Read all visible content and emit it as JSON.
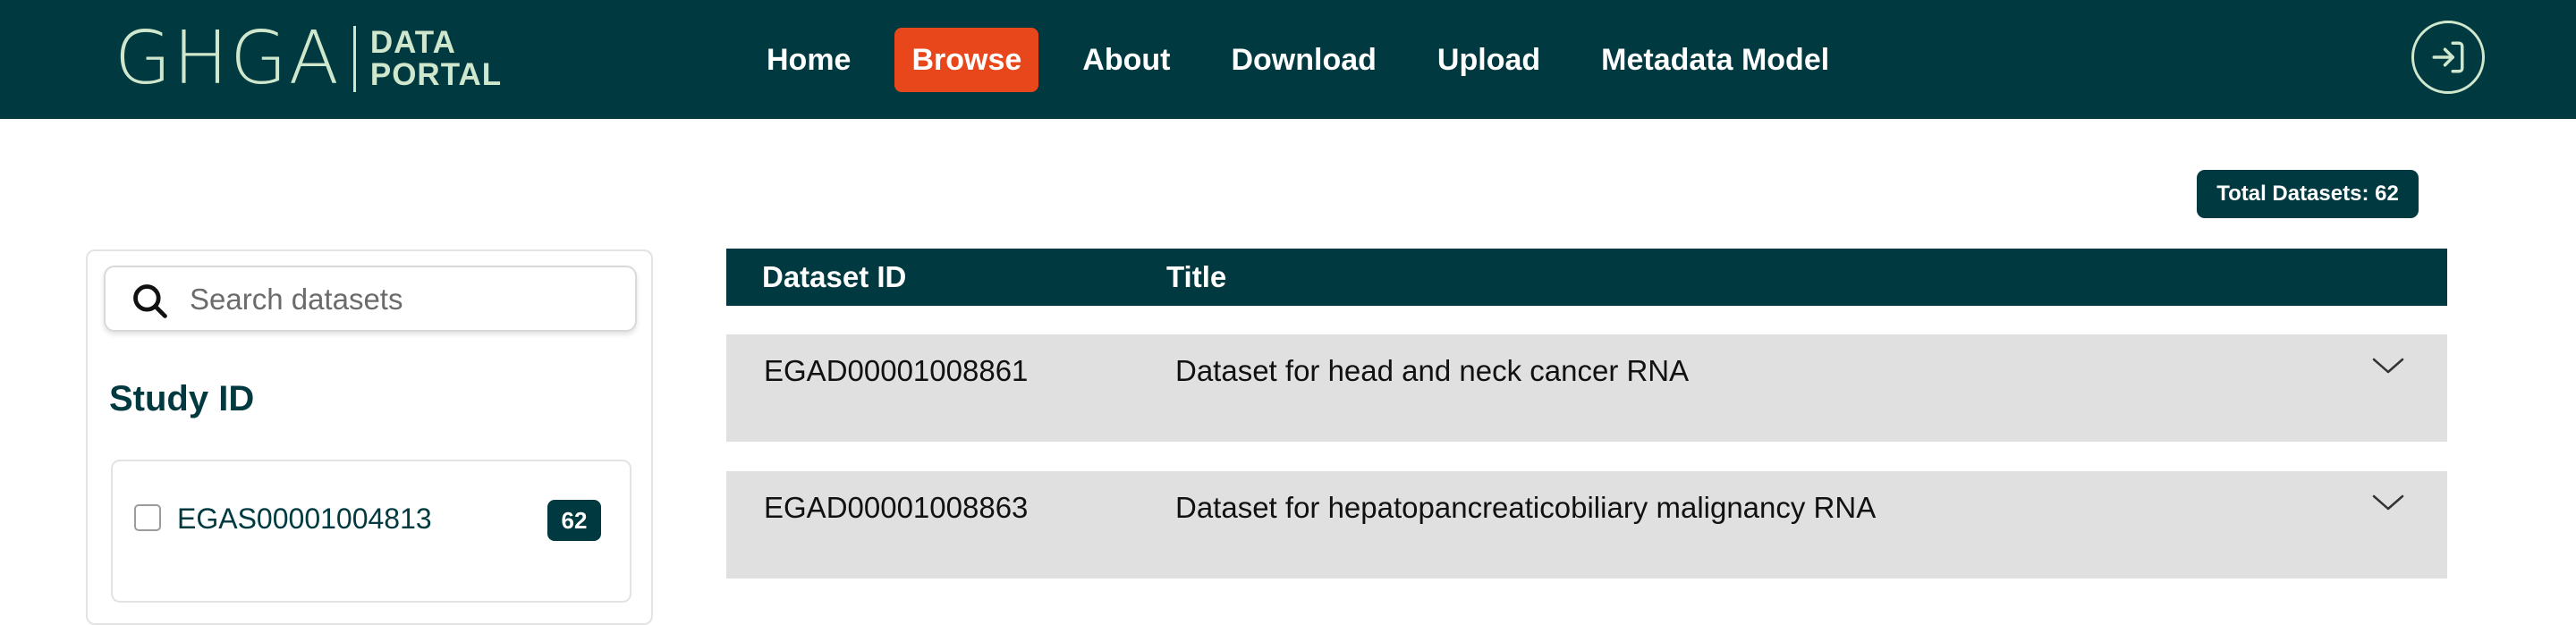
{
  "header": {
    "logo_mark": "GHGA",
    "logo_line1": "DATA",
    "logo_line2": "PORTAL",
    "nav": [
      {
        "label": "Home",
        "active": false
      },
      {
        "label": "Browse",
        "active": true
      },
      {
        "label": "About",
        "active": false
      },
      {
        "label": "Download",
        "active": false
      },
      {
        "label": "Upload",
        "active": false
      },
      {
        "label": "Metadata Model",
        "active": false
      }
    ],
    "login_icon": "login-icon"
  },
  "summary": {
    "total_label": "Total Datasets: 62"
  },
  "filters": {
    "search_placeholder": "Search datasets",
    "search_value": "",
    "study_title": "Study ID",
    "study_items": [
      {
        "label": "EGAS00001004813",
        "count": "62",
        "checked": false
      }
    ]
  },
  "table": {
    "columns": [
      "Dataset ID",
      "Title"
    ],
    "rows": [
      {
        "id": "EGAD00001008861",
        "title": "Dataset for head and neck cancer RNA"
      },
      {
        "id": "EGAD00001008863",
        "title": "Dataset for hepatopancreaticobiliary malignancy RNA"
      }
    ]
  },
  "colors": {
    "primary": "#00393f",
    "accent": "#e8471c",
    "logo": "#cfe7cd",
    "row_bg": "#e0e0e0"
  }
}
